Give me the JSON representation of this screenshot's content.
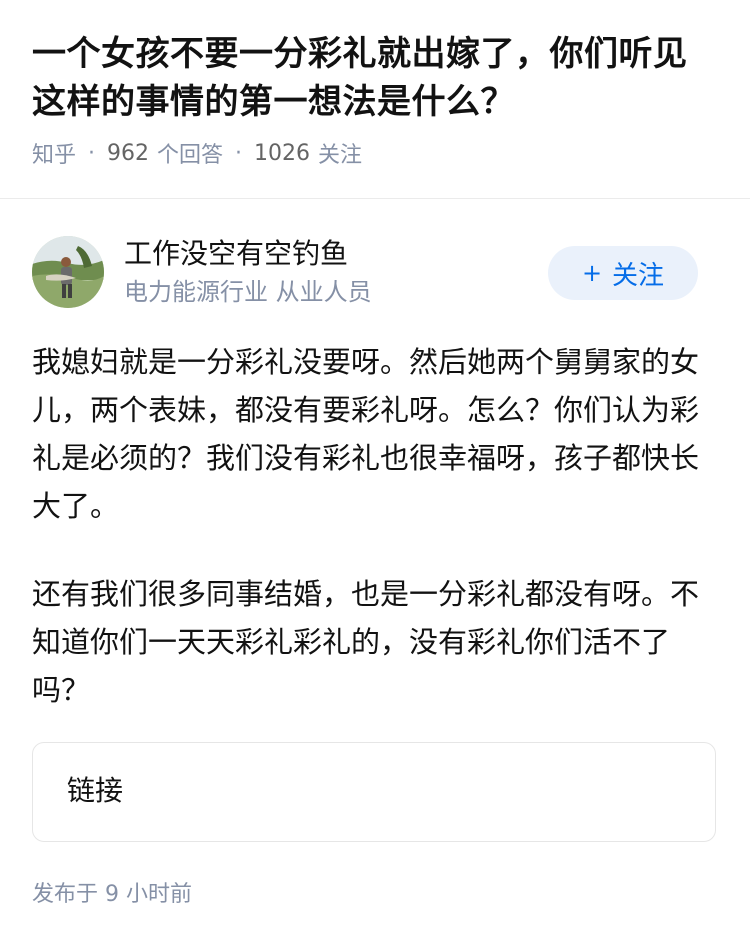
{
  "question": {
    "title": "一个女孩不要一分彩礼就出嫁了，你们听见这样的事情的第一想法是什么？",
    "source": "知乎",
    "answers_count": "962",
    "answers_label": "个回答",
    "follow_count": "1026",
    "follow_label": "关注",
    "separator": "·"
  },
  "author": {
    "name": "工作没空有空钓鱼",
    "bio": "电力能源行业 从业人员",
    "follow_button": "关注",
    "follow_plus": "+"
  },
  "answer": {
    "paragraphs": [
      "我媳妇就是一分彩礼没要呀。然后她两个舅舅家的女儿，两个表妹，都没有要彩礼呀。怎么？你们认为彩礼是必须的？我们没有彩礼也很幸福呀，孩子都快长大了。",
      "还有我们很多同事结婚，也是一分彩礼都没有呀。不知道你们一天天彩礼彩礼的，没有彩礼你们活不了吗？"
    ],
    "link_card_label": "链接",
    "published": "发布于 9 小时前"
  },
  "colors": {
    "accent": "#056de8",
    "follow_bg": "#eaf1fb",
    "meta_gray": "#8590a6"
  },
  "icons": {
    "avatar": "avatar-fisherman-photo"
  }
}
